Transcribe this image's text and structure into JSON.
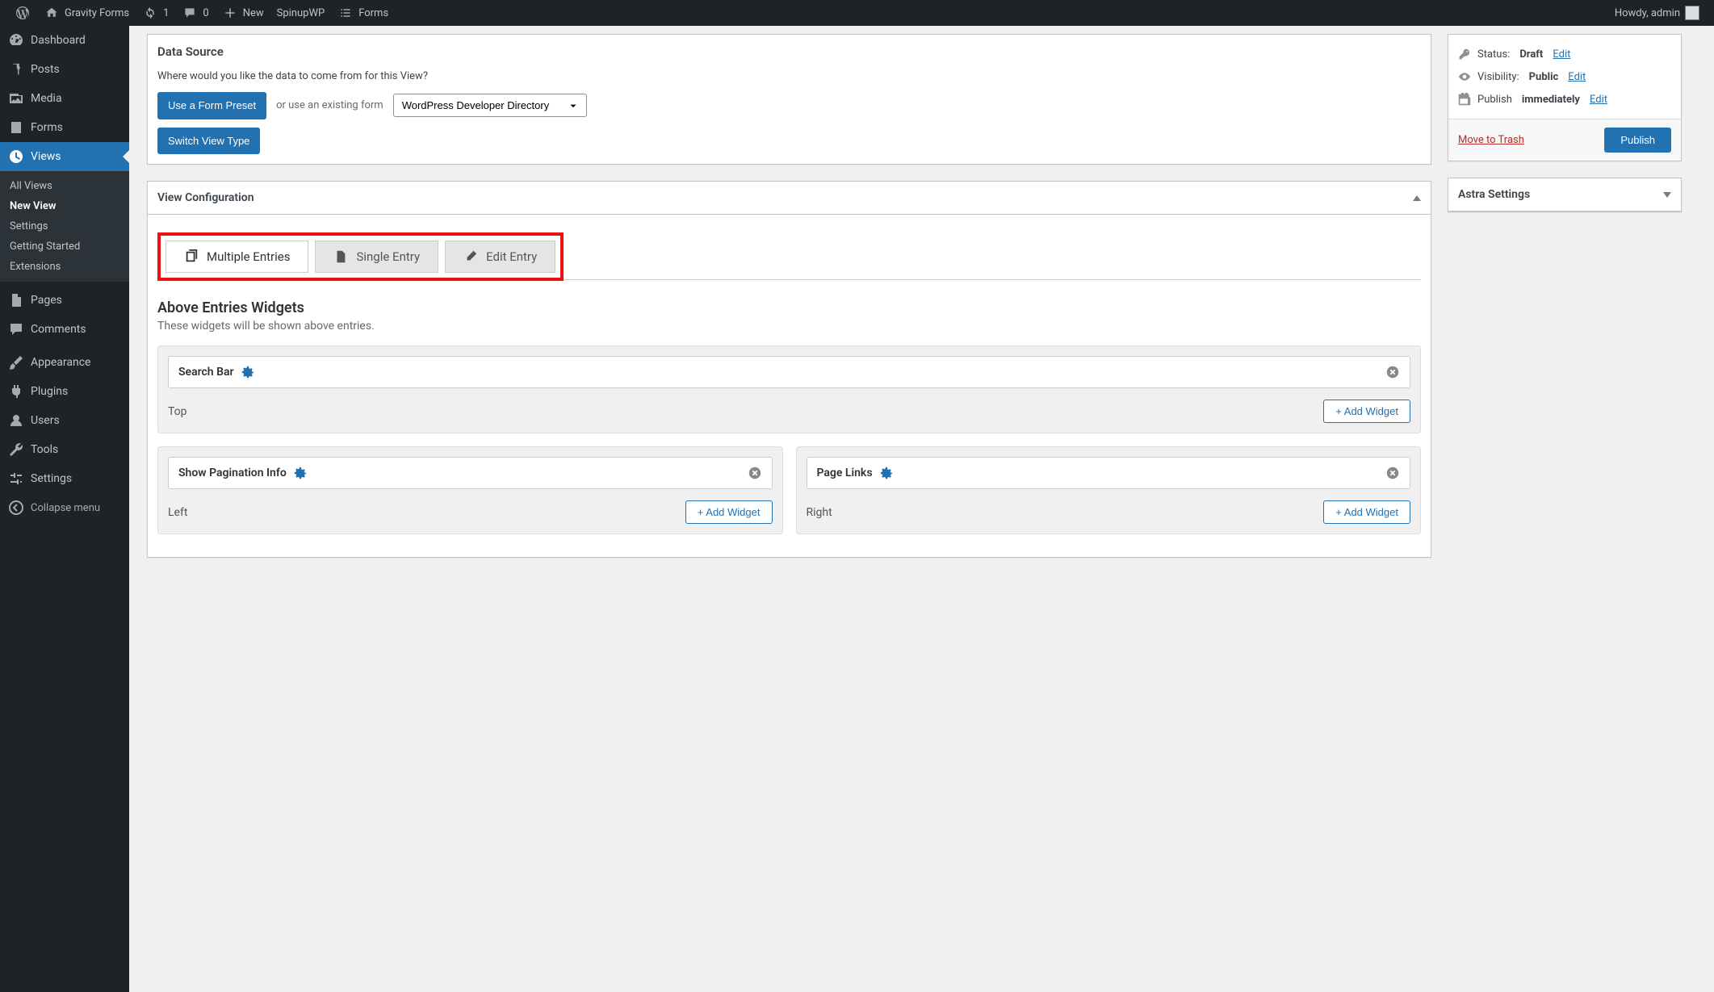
{
  "adminbar": {
    "site_name": "Gravity Forms",
    "updates_count": "1",
    "comments_count": "0",
    "new_label": "New",
    "spinupwp": "SpinupWP",
    "forms": "Forms",
    "howdy": "Howdy, admin"
  },
  "sidebar": [
    {
      "id": "dashboard",
      "label": "Dashboard",
      "icon": "dashboard"
    },
    {
      "id": "posts",
      "label": "Posts",
      "icon": "pin"
    },
    {
      "id": "media",
      "label": "Media",
      "icon": "media"
    },
    {
      "id": "forms",
      "label": "Forms",
      "icon": "forms"
    },
    {
      "id": "views",
      "label": "Views",
      "icon": "views",
      "current": true,
      "submenu": [
        {
          "label": "All Views",
          "current": false
        },
        {
          "label": "New View",
          "current": true
        },
        {
          "label": "Settings",
          "current": false
        },
        {
          "label": "Getting Started",
          "current": false
        },
        {
          "label": "Extensions",
          "current": false
        }
      ]
    },
    {
      "id": "pages",
      "label": "Pages",
      "icon": "pages"
    },
    {
      "id": "comments",
      "label": "Comments",
      "icon": "comment"
    },
    {
      "id": "appearance",
      "label": "Appearance",
      "icon": "brush"
    },
    {
      "id": "plugins",
      "label": "Plugins",
      "icon": "plug"
    },
    {
      "id": "users",
      "label": "Users",
      "icon": "user"
    },
    {
      "id": "tools",
      "label": "Tools",
      "icon": "wrench"
    },
    {
      "id": "settings",
      "label": "Settings",
      "icon": "sliders"
    }
  ],
  "collapse_label": "Collapse menu",
  "datasource": {
    "heading": "Data Source",
    "prompt": "Where would you like the data to come from for this View?",
    "preset_btn": "Use a Form Preset",
    "or_text": "or use an existing form",
    "form_selected": "WordPress Developer Directory",
    "switch_btn": "Switch View Type"
  },
  "viewconfig": {
    "heading": "View Configuration",
    "tabs": [
      {
        "label": "Multiple Entries",
        "active": true
      },
      {
        "label": "Single Entry",
        "active": false
      },
      {
        "label": "Edit Entry",
        "active": false
      }
    ],
    "above": {
      "title": "Above Entries Widgets",
      "subtitle": "These widgets will be shown above entries.",
      "top": {
        "label": "Top",
        "add": "+ Add Widget",
        "items": [
          {
            "name": "Search Bar"
          }
        ]
      },
      "left": {
        "label": "Left",
        "add": "+ Add Widget",
        "items": [
          {
            "name": "Show Pagination Info"
          }
        ]
      },
      "right": {
        "label": "Right",
        "add": "+ Add Widget",
        "items": [
          {
            "name": "Page Links"
          }
        ]
      }
    }
  },
  "publish": {
    "status_label": "Status:",
    "status_value": "Draft",
    "visibility_label": "Visibility:",
    "visibility_value": "Public",
    "publish_label": "Publish",
    "publish_value": "immediately",
    "edit": "Edit",
    "trash": "Move to Trash",
    "publish_btn": "Publish"
  },
  "astra": {
    "heading": "Astra Settings"
  }
}
